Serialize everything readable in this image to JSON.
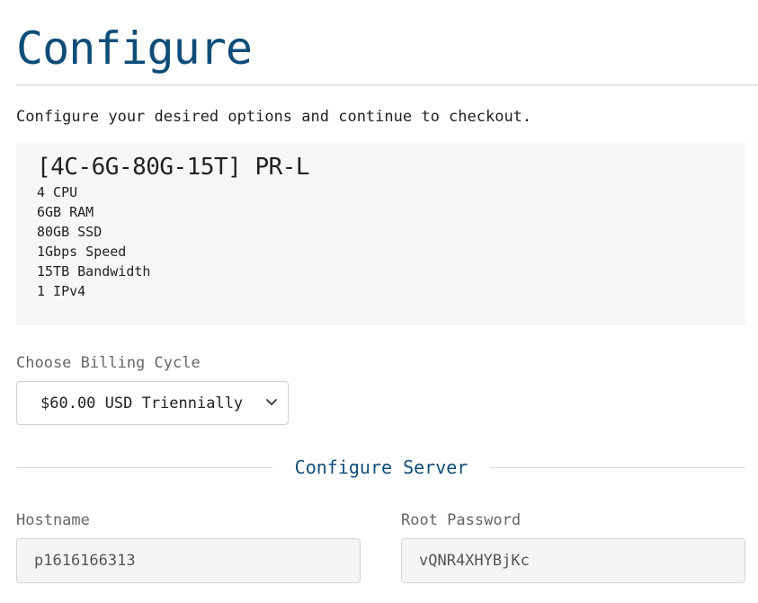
{
  "page": {
    "title": "Configure",
    "intro": "Configure your desired options and continue to checkout."
  },
  "product": {
    "name": "[4C-6G-80G-15T] PR-L",
    "features": [
      "4 CPU",
      "6GB RAM",
      "80GB SSD",
      "1Gbps Speed",
      "15TB Bandwidth",
      "1 IPv4"
    ]
  },
  "billing": {
    "label": "Choose Billing Cycle",
    "selected": "$60.00 USD Triennially"
  },
  "server": {
    "section_title": "Configure Server",
    "hostname_label": "Hostname",
    "hostname_value": "p1616166313",
    "password_label": "Root Password",
    "password_value": "vQNR4XHYBjKc"
  },
  "colors": {
    "accent": "#0e4d78",
    "box_background": "#f7f7f7",
    "label": "#666666"
  },
  "icons": {
    "billing_dropdown": "chevron-down-icon"
  }
}
